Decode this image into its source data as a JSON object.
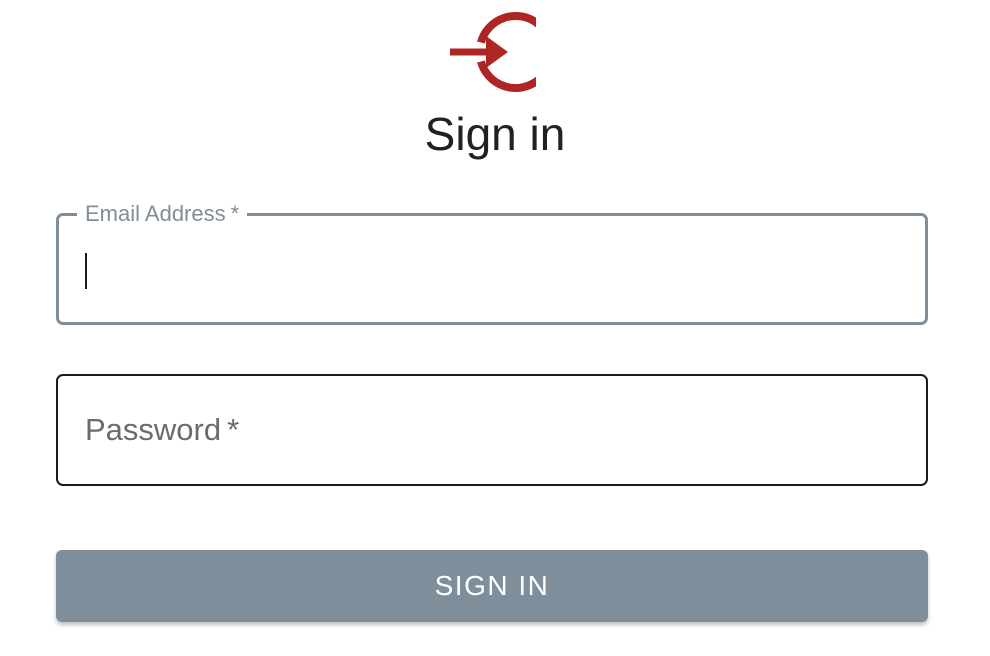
{
  "brand": {
    "icon": "login-arrow-icon",
    "accent_color": "#b02423"
  },
  "page": {
    "title": "Sign in"
  },
  "form": {
    "email": {
      "label": "Email Address",
      "required_marker": "*",
      "value": "",
      "focused": true
    },
    "password": {
      "label": "Password",
      "required_marker": "*",
      "value": ""
    },
    "submit_label": "SIGN IN",
    "button_color": "#7e8f9b"
  }
}
